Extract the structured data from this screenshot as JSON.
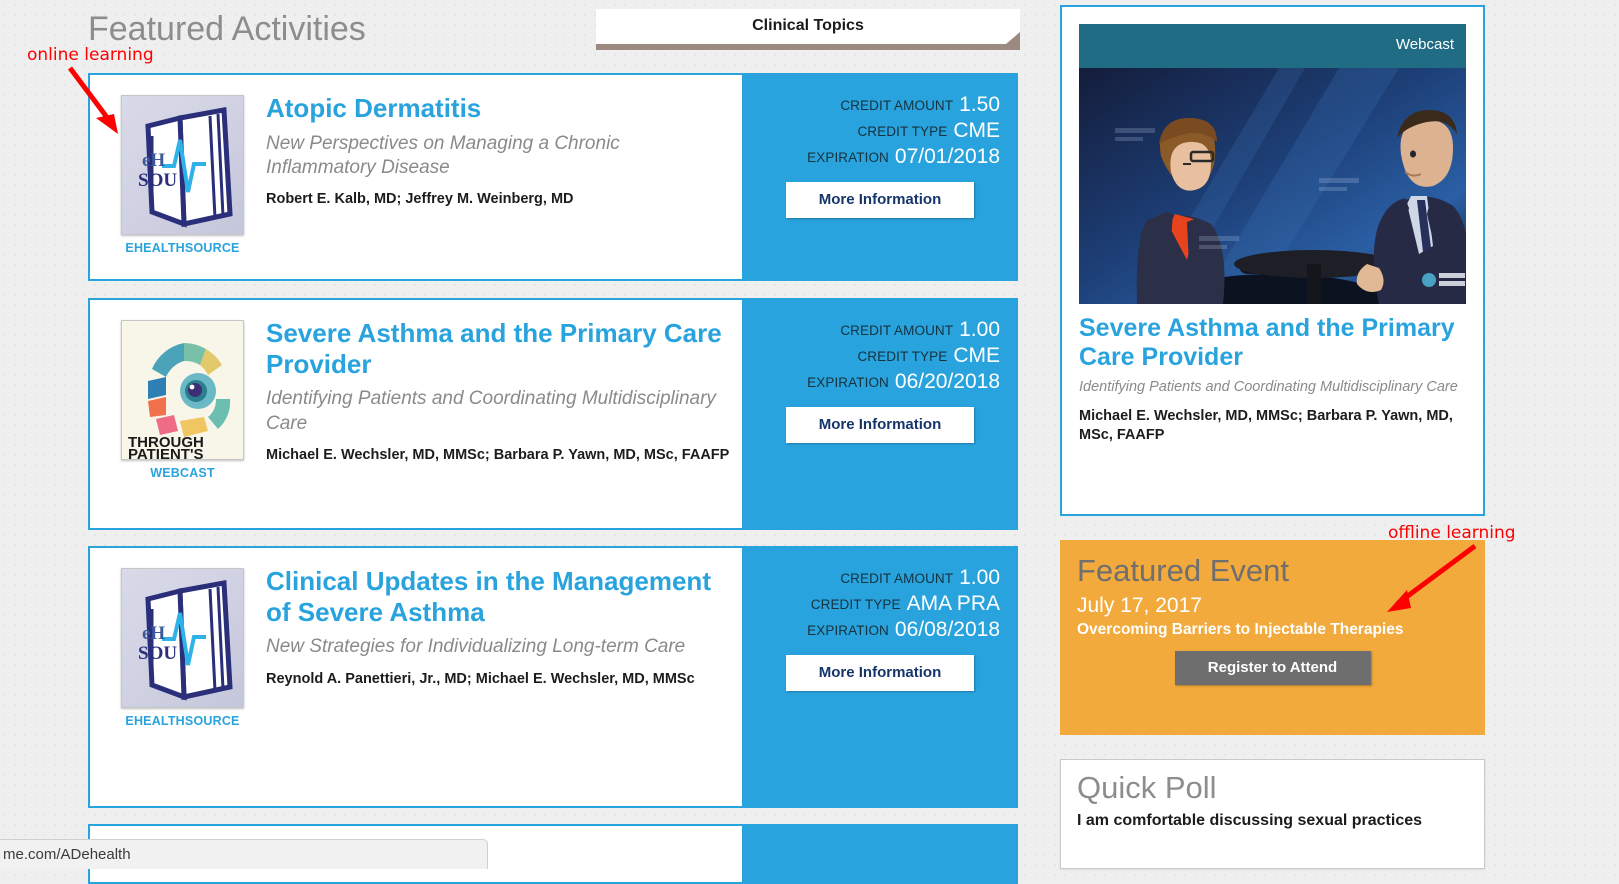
{
  "header": {
    "page_title": "Featured Activities",
    "clinical_topics_label": "Clinical Topics"
  },
  "activities": [
    {
      "title": "Atopic Dermatitis",
      "subtitle": "New Perspectives on Managing a Chronic Inflammatory Disease",
      "authors": "Robert E. Kalb, MD; Jeffrey M. Weinberg, MD",
      "thumb_caption": "EHEALTHSOURCE",
      "thumb_logo": "ehealthsource-logo",
      "credit_amount_label": "CREDIT AMOUNT",
      "credit_amount": "1.50",
      "credit_type_label": "CREDIT TYPE",
      "credit_type": "CME",
      "expiration_label": "EXPIRATION",
      "expiration": "07/01/2018",
      "more_info_label": "More Information"
    },
    {
      "title": "Severe Asthma and the Primary Care Provider",
      "subtitle": "Identifying Patients and Coordinating Multidisciplinary Care",
      "authors": "Michael E. Wechsler, MD, MMSc; Barbara P. Yawn, MD, MSc, FAAFP",
      "thumb_caption": "WEBCAST",
      "thumb_logo": "through-your-patients-eyes-logo",
      "credit_amount_label": "CREDIT AMOUNT",
      "credit_amount": "1.00",
      "credit_type_label": "CREDIT TYPE",
      "credit_type": "CME",
      "expiration_label": "EXPIRATION",
      "expiration": "06/20/2018",
      "more_info_label": "More Information"
    },
    {
      "title": "Clinical Updates in the Management of Severe Asthma",
      "subtitle": "New Strategies for Individualizing Long-term Care",
      "authors": "Reynold A. Panettieri, Jr., MD; Michael E. Wechsler, MD, MMSc",
      "thumb_caption": "EHEALTHSOURCE",
      "thumb_logo": "ehealthsource-logo",
      "credit_amount_label": "CREDIT AMOUNT",
      "credit_amount": "1.00",
      "credit_type_label": "CREDIT TYPE",
      "credit_type": "AMA PRA",
      "expiration_label": "EXPIRATION",
      "expiration": "06/08/2018",
      "more_info_label": "More Information"
    }
  ],
  "sidebar": {
    "webcast_card": {
      "badge": "Webcast",
      "title": "Severe Asthma and the Primary Care Provider",
      "subtitle": "Identifying Patients and Coordinating Multidisciplinary Care",
      "authors": "Michael E. Wechsler, MD, MMSc; Barbara P. Yawn, MD, MSc, FAAFP"
    },
    "featured_event": {
      "heading": "Featured Event",
      "date": "July 17, 2017",
      "name": "Overcoming Barriers to Injectable Therapies",
      "button_label": "Register to Attend"
    },
    "quick_poll": {
      "heading": "Quick Poll",
      "question": "I am comfortable discussing sexual practices"
    }
  },
  "annotations": {
    "online": "online learning",
    "offline": "offline learning",
    "color": "#ff0000"
  },
  "status_bar": {
    "url": "me.com/ADehealth"
  },
  "theme": {
    "accent_blue": "#29a3dd",
    "event_orange": "#f2aa3c",
    "heading_gray": "#8d8d8d",
    "webcast_header_teal": "#1f6c84",
    "dropdown_underline": "#9c8a80",
    "page_background": "#efefef"
  }
}
